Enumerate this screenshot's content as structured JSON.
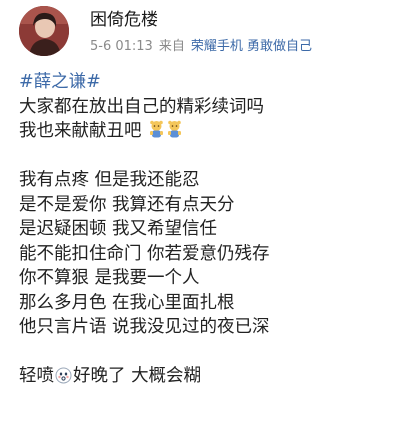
{
  "post": {
    "author": "困倚危楼",
    "date": "5-6 01:13",
    "source_prefix": "来自",
    "source": "荣耀手机 勇敢做自己",
    "topic": "#薛之谦#",
    "line_1": "大家都在放出自己的精彩续词吗",
    "line_2": "我也来献献丑吧",
    "lyrics": [
      "我有点疼 但是我还能忍",
      "是不是爱你 我算还有点天分",
      "是迟疑困顿 我又希望信任",
      "能不能扣住命门 你若爱意仍残存",
      "你不算狠 是我要一个人",
      "那么多月色 在我心里面扎根",
      "他只言片语 说我没见过的夜已深"
    ],
    "closing_before": "轻喷",
    "closing_after": "好晚了 大概会糊"
  },
  "icons": {
    "shy_emoji": "bashful-bear-emoji",
    "face_emoji": "whistle-face-emoji"
  },
  "colors": {
    "link": "#3d6aa8",
    "meta": "#8a8a8a",
    "text": "#222222"
  }
}
